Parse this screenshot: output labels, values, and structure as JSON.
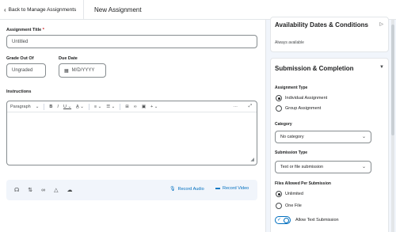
{
  "header": {
    "back_label": "Back to Manage Assignments",
    "title": "New Assignment"
  },
  "form": {
    "title_label": "Assignment Title",
    "required_mark": "*",
    "title_value": "Untitled",
    "grade_label": "Grade Out Of",
    "grade_value": "Ungraded",
    "due_label": "Due Date",
    "due_placeholder": "M/D/YYYY",
    "instructions_label": "Instructions",
    "editor_paragraph": "Paragraph",
    "record_audio": "Record Audio",
    "record_video": "Record Video"
  },
  "sidebar": {
    "availability": {
      "title": "Availability Dates & Conditions",
      "summary": "Always available"
    },
    "submission": {
      "title": "Submission & Completion",
      "assignment_type_label": "Assignment Type",
      "types": [
        {
          "label": "Individual Assignment",
          "selected": true
        },
        {
          "label": "Group Assignment",
          "selected": false
        }
      ],
      "category_label": "Category",
      "category_value": "No category",
      "submission_type_label": "Submission Type",
      "submission_type_value": "Text or file submission",
      "files_label": "Files Allowed Per Submission",
      "files": [
        {
          "label": "Unlimited",
          "selected": true
        },
        {
          "label": "One File",
          "selected": false
        }
      ],
      "allow_text_label": "Allow Text Submission",
      "allow_text_on": true
    }
  },
  "colors": {
    "accent": "#006fbf",
    "required": "#cd2026",
    "sidebar_bg": "#f1f5fb"
  }
}
